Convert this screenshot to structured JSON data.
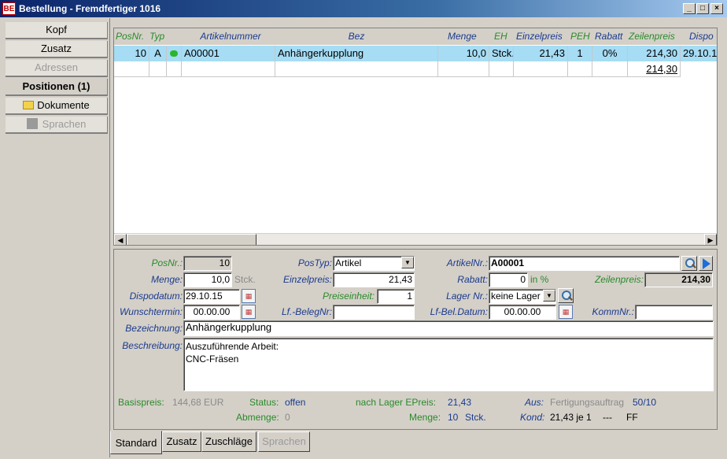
{
  "window": {
    "title": "Bestellung - Fremdfertiger  1016",
    "app_icon": "BE",
    "minimize": "_",
    "maximize": "□",
    "close": "×"
  },
  "nav": [
    {
      "label": "Kopf",
      "state": "normal"
    },
    {
      "label": "Zusatz",
      "state": "normal"
    },
    {
      "label": "Adressen",
      "state": "disabled"
    },
    {
      "label": "Positionen (1)",
      "state": "active"
    },
    {
      "label": "Dokumente",
      "state": "normal",
      "icon": "folder-icon"
    },
    {
      "label": "Sprachen",
      "state": "disabled",
      "icon": "grey-square-icon"
    }
  ],
  "grid": {
    "columns": [
      "PosNr.",
      "Typ",
      "",
      "Artikelnummer",
      "Bez",
      "Menge",
      "EH",
      "Einzelpreis",
      "PEH",
      "Rabatt",
      "Zeilenpreis",
      "Dispo"
    ],
    "rows": [
      {
        "posnr": "10",
        "typ": "A",
        "status_icon": "green-dot-icon",
        "artikelnummer": "A00001",
        "bez": "Anhängerkupplung",
        "menge": "10,0",
        "eh": "Stck.",
        "einzelpreis": "21,43",
        "peh": "1",
        "rabatt": "0%",
        "zeilenpreis": "214,30",
        "dispo": "29.10.1"
      }
    ],
    "total": "214,30",
    "scroll_left": "◀",
    "scroll_right": "▶"
  },
  "form": {
    "posnr": {
      "label": "PosNr.:",
      "value": "10"
    },
    "postyp": {
      "label": "PosTyp:",
      "value": "Artikel"
    },
    "artikelnr": {
      "label": "ArtikelNr.:",
      "value": "A00001"
    },
    "menge": {
      "label": "Menge:",
      "value": "10,0",
      "unit": "Stck."
    },
    "einzelpreis": {
      "label": "Einzelpreis:",
      "value": "21,43"
    },
    "rabatt": {
      "label": "Rabatt:",
      "value": "0",
      "unit": "in %"
    },
    "zeilenpreis": {
      "label": "Zeilenpreis:",
      "value": "214,30"
    },
    "dispodatum": {
      "label": "Dispodatum:",
      "value": "29.10.15"
    },
    "preiseinheit": {
      "label": "Preiseinheit:",
      "value": "1"
    },
    "lager": {
      "label": "Lager Nr.:",
      "value": "keine Lager"
    },
    "wunschtermin": {
      "label": "Wunschtermin:",
      "value": "00.00.00"
    },
    "lfbelegnr": {
      "label": "Lf.-BelegNr:",
      "value": ""
    },
    "lfbeldatum": {
      "label": "Lf-Bel.Datum:",
      "value": "00.00.00"
    },
    "kommnr": {
      "label": "KommNr.:",
      "value": ""
    },
    "bezeichnung": {
      "label": "Bezeichnung:",
      "value": "Anhängerkupplung"
    },
    "beschreibung": {
      "label": "Beschreibung:",
      "lines": [
        "Auszuführende Arbeit:",
        "CNC-Fräsen"
      ]
    }
  },
  "info": {
    "basispreis_label": "Basispreis:",
    "basispreis_value": "144,68 EUR",
    "status_label": "Status:",
    "status_value": "offen",
    "abmenge_label": "Abmenge:",
    "abmenge_value": "0",
    "nach_lager_label": "nach Lager EPreis:",
    "nach_lager_value": "21,43",
    "menge_label": "Menge:",
    "menge_value": "10",
    "menge_unit": "Stck.",
    "aus_label": "Aus:",
    "aus_value": "Fertigungsauftrag",
    "aus_ref": "50/10",
    "kond_label": "Kond:",
    "kond_value": "21,43 je 1",
    "kond_dash": "---",
    "kond_ff": "FF"
  },
  "tabs": [
    {
      "label": "Standard",
      "state": "active"
    },
    {
      "label": "Zusatz",
      "state": "normal"
    },
    {
      "label": "Zuschläge",
      "state": "normal"
    },
    {
      "label": "Sprachen",
      "state": "disabled"
    }
  ]
}
